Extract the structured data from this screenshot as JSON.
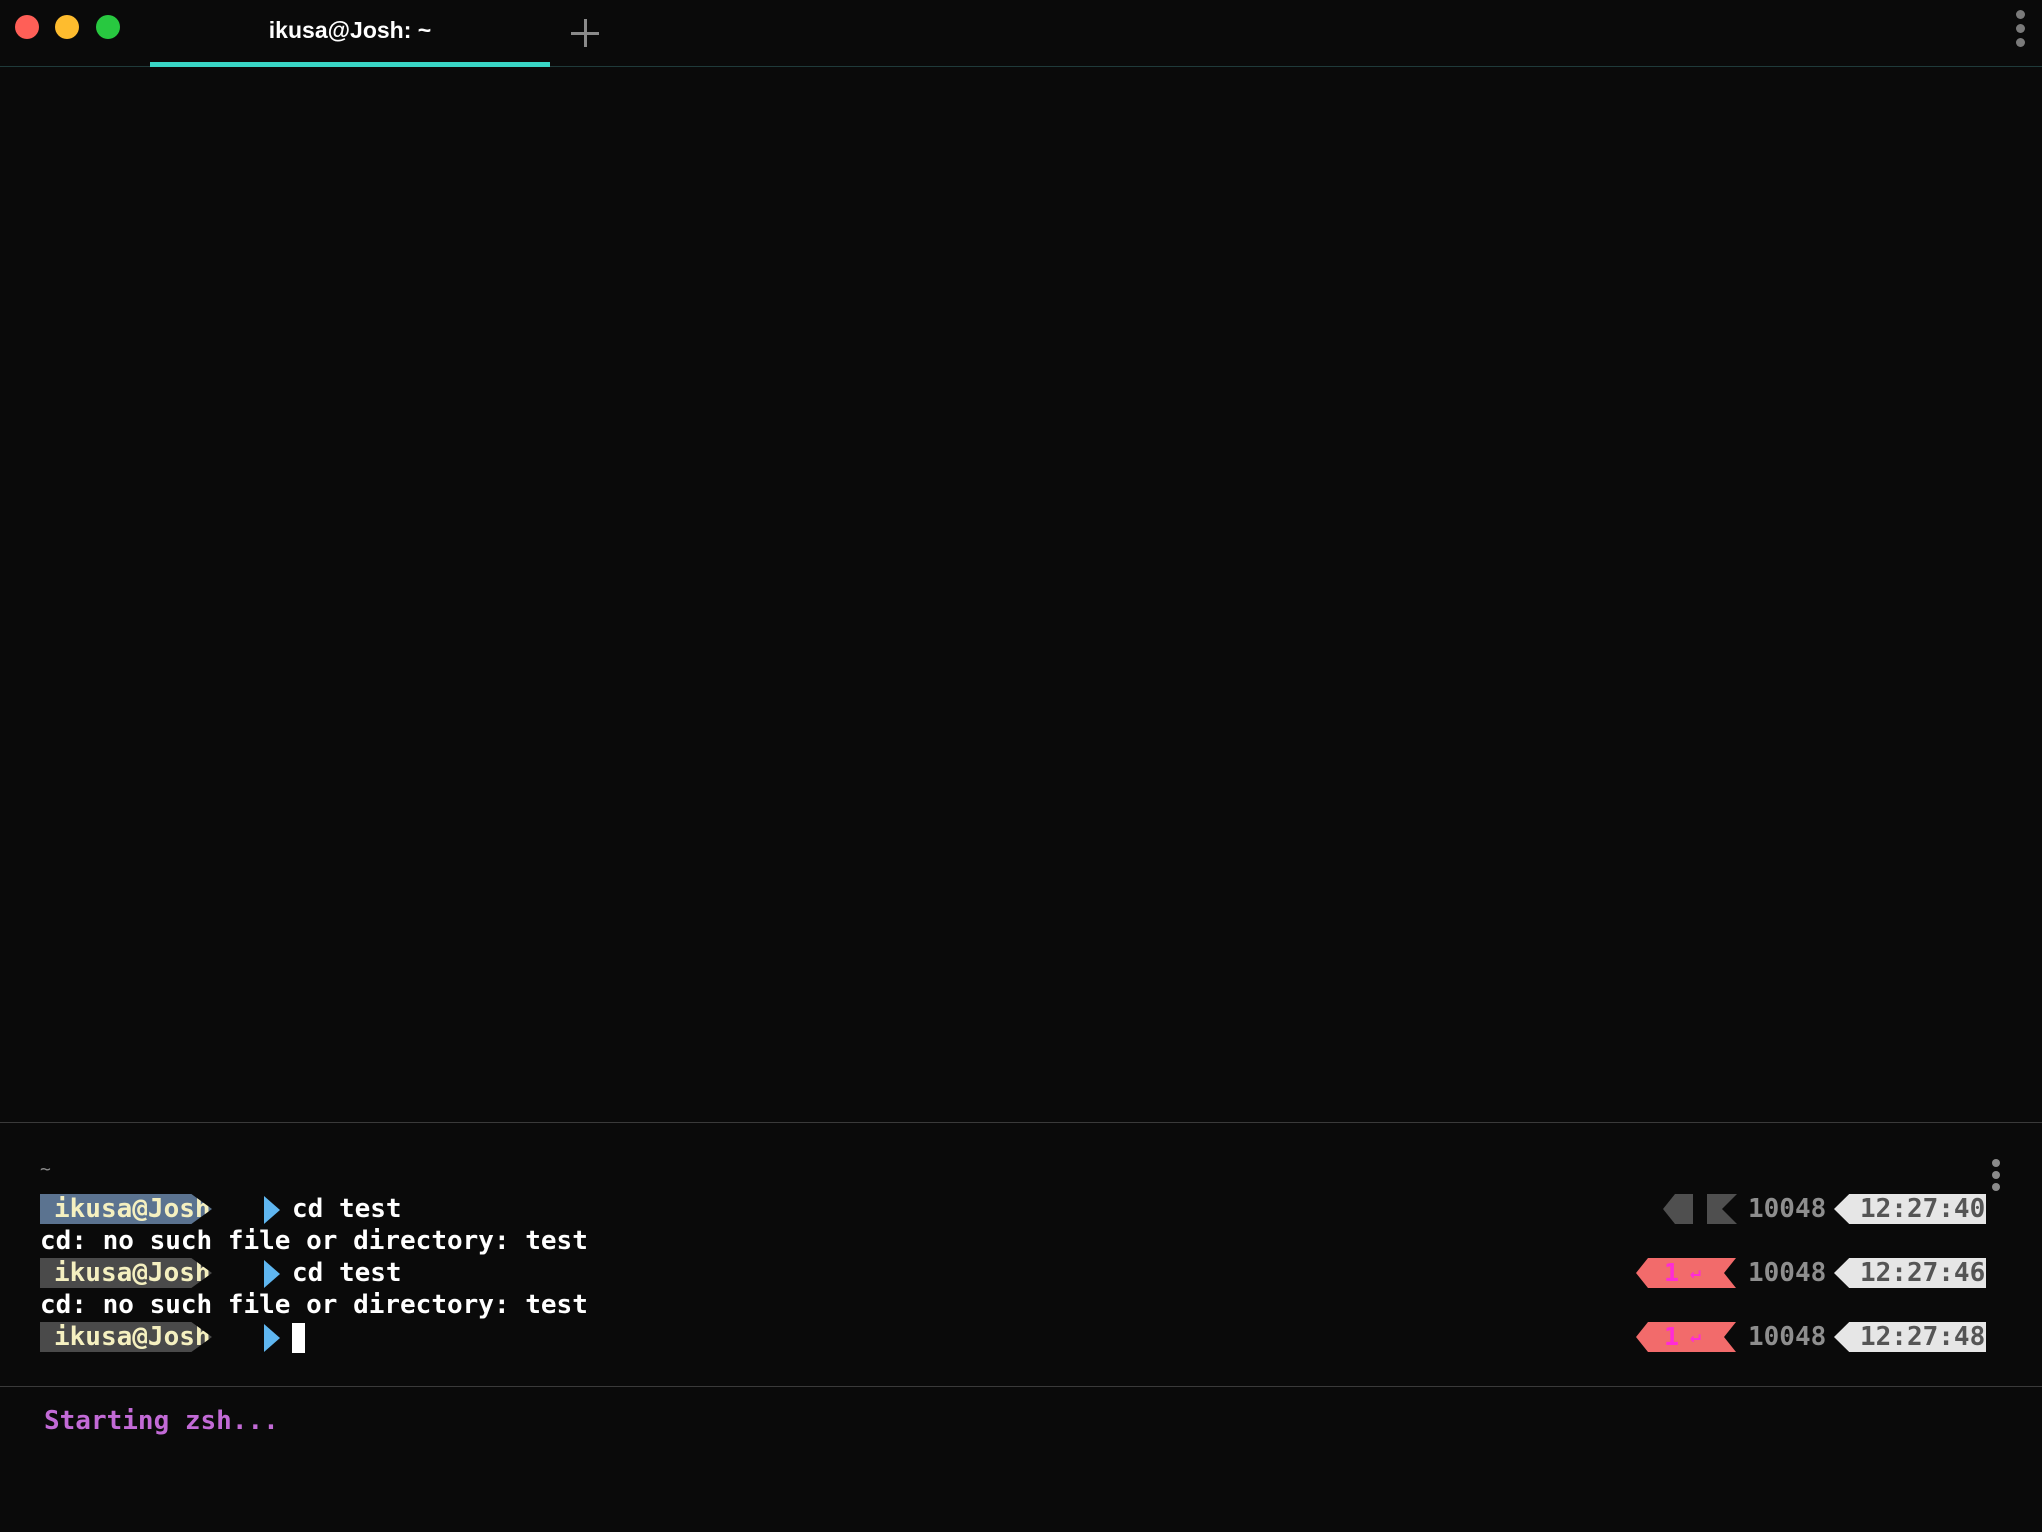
{
  "window": {
    "tab_title": "ikusa@Josh: ~",
    "new_tab_icon": "plus-icon",
    "menu_icon": "kebab-icon"
  },
  "block": {
    "cwd": "~",
    "lines": [
      {
        "type": "prompt",
        "user": "ikusa@Josh",
        "command": "cd test",
        "exit_code": "",
        "return_icon": "",
        "pid": "10048",
        "time": "12:27:40"
      },
      {
        "type": "output",
        "text": "cd: no such file or directory: test"
      },
      {
        "type": "prompt",
        "user": "ikusa@Josh",
        "command": "cd test",
        "exit_code": "1",
        "return_icon": "↵",
        "pid": "10048",
        "time": "12:27:46"
      },
      {
        "type": "output",
        "text": "cd: no such file or directory: test"
      },
      {
        "type": "prompt",
        "user": "ikusa@Josh",
        "command": "",
        "exit_code": "1",
        "return_icon": "↵",
        "pid": "10048",
        "time": "12:27:48"
      }
    ]
  },
  "input": {
    "status_text": "Starting zsh..."
  },
  "colors": {
    "background": "#0a0a0a",
    "tab_accent": "#39d6c6",
    "user_segment_first": "#5b7390",
    "user_segment": "#4a4a4a",
    "prompt_chevron": "#5fb6f0",
    "error_segment": "#f26b6b",
    "error_text": "#ff2bd6",
    "time_segment": "#e6e6e6",
    "status_text": "#c26ad6"
  }
}
